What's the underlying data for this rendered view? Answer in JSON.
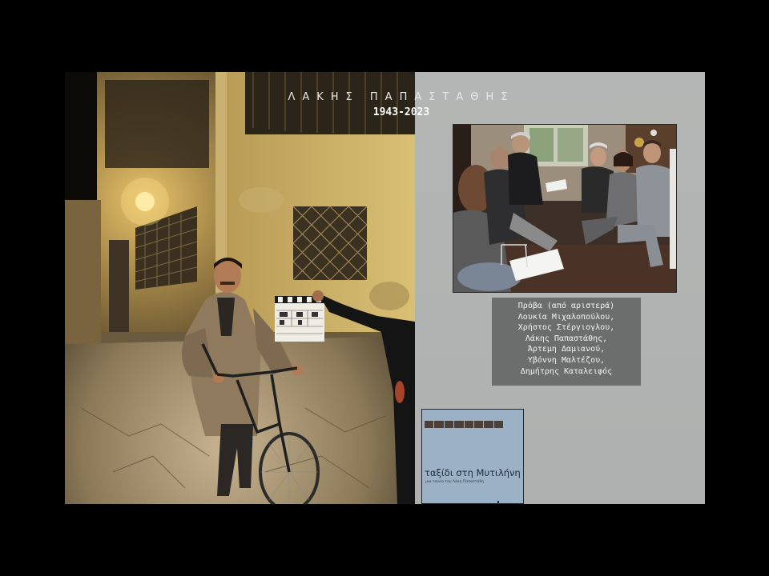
{
  "title": "ΛΑΚΗΣ ΠΑΠΑΣΤΑΘΗΣ",
  "years": "1943-2023",
  "caption": {
    "lines": [
      "Πρόβα (από αριστερά)",
      "Λουκία Μιχαλοπούλου,",
      "Χρήστος Στέργιογλου,",
      "Λάκης Παπαστάθης,",
      "Άρτεμη Δαμιανού,",
      "Υβόννη Μαλτέζου,",
      "Δημήτρης Καταλειφός"
    ]
  },
  "poster": {
    "title": "ταξίδι στη Μυτιλήνη",
    "subtitle": "μια ταινία του Λάκη Παπαστάθη"
  },
  "images": {
    "left_photo": "film-set-night-bicycle-clapperboard",
    "rehearsal_photo": "rehearsal-group-seated",
    "poster_image": "film-poster"
  },
  "colors": {
    "background": "#000000",
    "panel": "#b3b5b4",
    "caption_bg": "#6c6e6e",
    "poster_bg": "#9bb1c5"
  }
}
